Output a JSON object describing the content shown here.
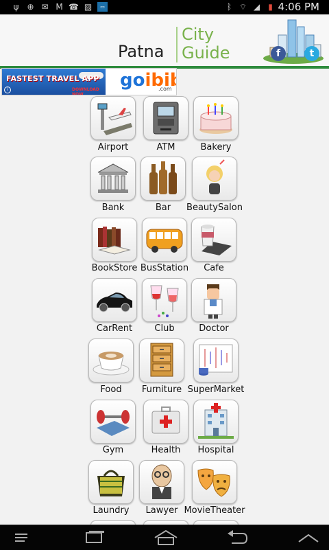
{
  "status_bar": {
    "time": "4:06 PM",
    "left_icons": [
      "usb-icon",
      "gps-icon",
      "mail-icon",
      "gmail-icon",
      "missed-call-icon",
      "no-image-icon",
      "app-notification-icon"
    ],
    "right_icons": [
      "bluetooth-icon",
      "wifi-icon",
      "signal-icon",
      "battery-icon"
    ]
  },
  "header": {
    "city": "Patna",
    "app_title_line1": "City",
    "app_title_line2": "Guide",
    "facebook_label": "f",
    "twitter_label": "t"
  },
  "ad": {
    "headline": "FASTEST TRAVEL APP",
    "cta": "DOWNLOAD NOW",
    "brand_part1": "go",
    "brand_part2": "ibibo",
    "brand_suffix": ".com",
    "info_label": "i"
  },
  "categories": [
    {
      "label": "Airport",
      "icon": "airport-icon"
    },
    {
      "label": "ATM",
      "icon": "atm-icon"
    },
    {
      "label": "Bakery",
      "icon": "cake-icon"
    },
    {
      "label": "Bank",
      "icon": "bank-icon"
    },
    {
      "label": "Bar",
      "icon": "beer-bottles-icon"
    },
    {
      "label": "BeautySalon",
      "icon": "salon-woman-icon"
    },
    {
      "label": "BookStore",
      "icon": "books-icon"
    },
    {
      "label": "BusStation",
      "icon": "bus-icon"
    },
    {
      "label": "Cafe",
      "icon": "coffee-cup-icon"
    },
    {
      "label": "CarRent",
      "icon": "car-icon"
    },
    {
      "label": "Club",
      "icon": "wine-glasses-icon"
    },
    {
      "label": "Doctor",
      "icon": "doctor-icon"
    },
    {
      "label": "Food",
      "icon": "cappuccino-icon"
    },
    {
      "label": "Furniture",
      "icon": "drawer-cabinet-icon"
    },
    {
      "label": "SuperMarket",
      "icon": "market-chart-icon"
    },
    {
      "label": "Gym",
      "icon": "dumbbell-icon"
    },
    {
      "label": "Health",
      "icon": "first-aid-icon"
    },
    {
      "label": "Hospital",
      "icon": "hospital-icon"
    },
    {
      "label": "Laundry",
      "icon": "laundry-icon"
    },
    {
      "label": "Lawyer",
      "icon": "lawyer-icon"
    },
    {
      "label": "MovieTheater",
      "icon": "theater-masks-icon"
    }
  ],
  "nav_bar": {
    "buttons": [
      "menu-icon",
      "recent-apps-icon",
      "home-icon",
      "back-icon",
      "collapse-icon"
    ]
  }
}
